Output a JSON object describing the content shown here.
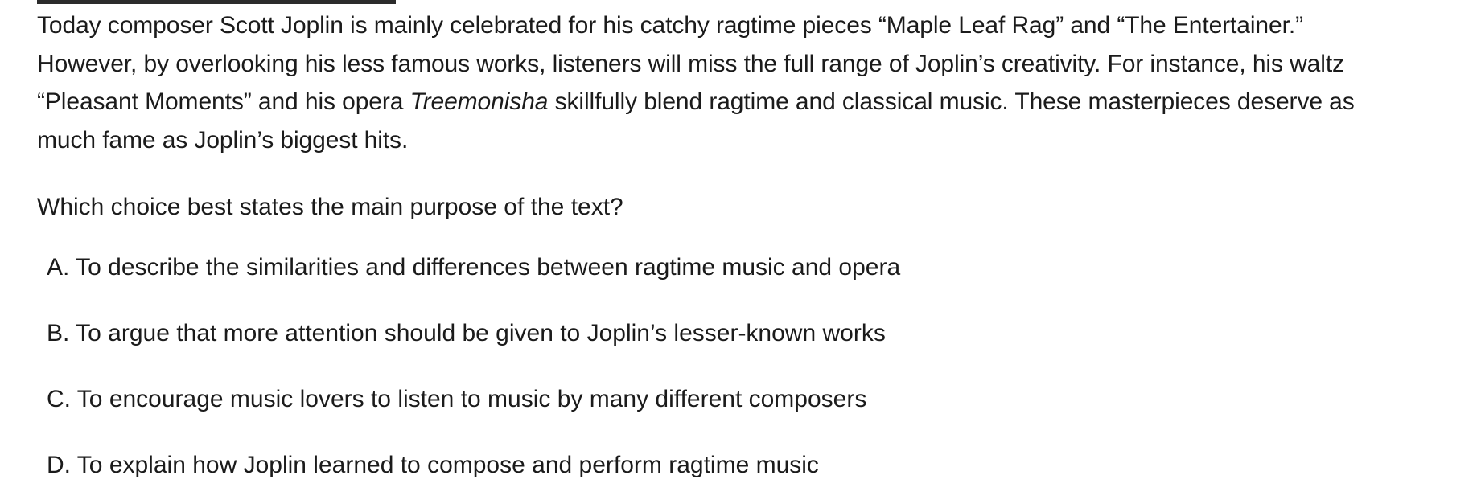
{
  "passage": {
    "line1": "Today composer Scott Joplin is mainly celebrated for his catchy ragtime pieces “Maple Leaf Rag” and “The Entertainer.”",
    "line2": "However, by overlooking his less famous works, listeners will miss the full range of Joplin’s creativity. For instance, his waltz",
    "line3_before": "“Pleasant Moments” and his opera ",
    "line3_italic": "Treemonisha",
    "line3_after": " skillfully blend ragtime and classical music. These masterpieces deserve as",
    "line4": "much fame as Joplin’s biggest hits."
  },
  "question": "Which choice best states the main purpose of the text?",
  "choices": [
    {
      "letter": "A.",
      "text": "To describe the similarities and differences between ragtime music and opera"
    },
    {
      "letter": "B.",
      "text": "To argue that more attention should be given to Joplin’s lesser-known works"
    },
    {
      "letter": "C.",
      "text": "To encourage music lovers to listen to music by many different composers"
    },
    {
      "letter": "D.",
      "text": "To explain how Joplin learned to compose and perform ragtime music"
    }
  ]
}
